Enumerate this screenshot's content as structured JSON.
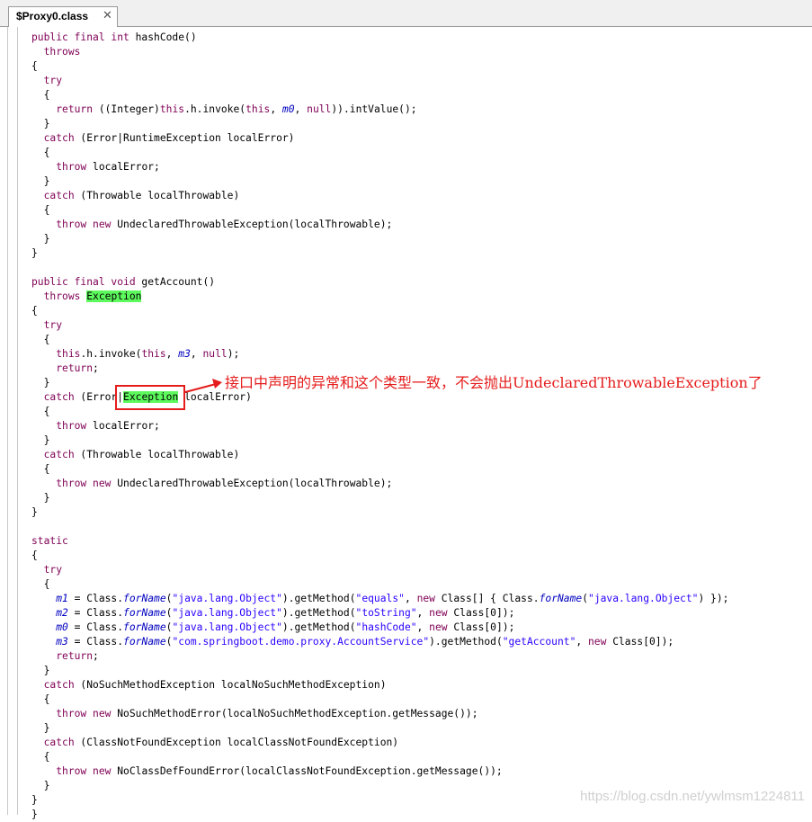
{
  "tab": {
    "title": "$Proxy0.class",
    "close_glyph": "✕"
  },
  "code_lines": [
    [
      {
        "t": "public final int",
        "c": "k"
      },
      {
        "t": " hashCode()",
        "c": "p"
      }
    ],
    [
      {
        "t": "  ",
        "c": "p"
      },
      {
        "t": "throws",
        "c": "k"
      }
    ],
    [
      {
        "t": "{",
        "c": "p"
      }
    ],
    [
      {
        "t": "  ",
        "c": "p"
      },
      {
        "t": "try",
        "c": "k"
      }
    ],
    [
      {
        "t": "  {",
        "c": "p"
      }
    ],
    [
      {
        "t": "    ",
        "c": "p"
      },
      {
        "t": "return",
        "c": "k"
      },
      {
        "t": " ((Integer)",
        "c": "p"
      },
      {
        "t": "this",
        "c": "k"
      },
      {
        "t": ".h.invoke(",
        "c": "p"
      },
      {
        "t": "this",
        "c": "k"
      },
      {
        "t": ", ",
        "c": "p"
      },
      {
        "t": "m0",
        "c": "f"
      },
      {
        "t": ", ",
        "c": "p"
      },
      {
        "t": "null",
        "c": "k"
      },
      {
        "t": ")).intValue();",
        "c": "p"
      }
    ],
    [
      {
        "t": "  }",
        "c": "p"
      }
    ],
    [
      {
        "t": "  ",
        "c": "p"
      },
      {
        "t": "catch",
        "c": "k"
      },
      {
        "t": " (Error|RuntimeException localError)",
        "c": "p"
      }
    ],
    [
      {
        "t": "  {",
        "c": "p"
      }
    ],
    [
      {
        "t": "    ",
        "c": "p"
      },
      {
        "t": "throw",
        "c": "k"
      },
      {
        "t": " localError;",
        "c": "p"
      }
    ],
    [
      {
        "t": "  }",
        "c": "p"
      }
    ],
    [
      {
        "t": "  ",
        "c": "p"
      },
      {
        "t": "catch",
        "c": "k"
      },
      {
        "t": " (Throwable localThrowable)",
        "c": "p"
      }
    ],
    [
      {
        "t": "  {",
        "c": "p"
      }
    ],
    [
      {
        "t": "    ",
        "c": "p"
      },
      {
        "t": "throw new",
        "c": "k"
      },
      {
        "t": " UndeclaredThrowableException(localThrowable);",
        "c": "p"
      }
    ],
    [
      {
        "t": "  }",
        "c": "p"
      }
    ],
    [
      {
        "t": "}",
        "c": "p"
      }
    ],
    [],
    [
      {
        "t": "public final void",
        "c": "k"
      },
      {
        "t": " getAccount()",
        "c": "p"
      }
    ],
    [
      {
        "t": "  ",
        "c": "p"
      },
      {
        "t": "throws",
        "c": "k"
      },
      {
        "t": " ",
        "c": "p"
      },
      {
        "t": "Exception",
        "c": "hl"
      }
    ],
    [
      {
        "t": "{",
        "c": "p"
      }
    ],
    [
      {
        "t": "  ",
        "c": "p"
      },
      {
        "t": "try",
        "c": "k"
      }
    ],
    [
      {
        "t": "  {",
        "c": "p"
      }
    ],
    [
      {
        "t": "    ",
        "c": "p"
      },
      {
        "t": "this",
        "c": "k"
      },
      {
        "t": ".h.invoke(",
        "c": "p"
      },
      {
        "t": "this",
        "c": "k"
      },
      {
        "t": ", ",
        "c": "p"
      },
      {
        "t": "m3",
        "c": "f"
      },
      {
        "t": ", ",
        "c": "p"
      },
      {
        "t": "null",
        "c": "k"
      },
      {
        "t": ");",
        "c": "p"
      }
    ],
    [
      {
        "t": "    ",
        "c": "p"
      },
      {
        "t": "return",
        "c": "k"
      },
      {
        "t": ";",
        "c": "p"
      }
    ],
    [
      {
        "t": "  }",
        "c": "p"
      }
    ],
    [
      {
        "t": "  ",
        "c": "p"
      },
      {
        "t": "catch",
        "c": "k"
      },
      {
        "t": " (Error|",
        "c": "p"
      },
      {
        "t": "Exception",
        "c": "hl"
      },
      {
        "t": " localError)",
        "c": "p"
      }
    ],
    [
      {
        "t": "  {",
        "c": "p"
      }
    ],
    [
      {
        "t": "    ",
        "c": "p"
      },
      {
        "t": "throw",
        "c": "k"
      },
      {
        "t": " localError;",
        "c": "p"
      }
    ],
    [
      {
        "t": "  }",
        "c": "p"
      }
    ],
    [
      {
        "t": "  ",
        "c": "p"
      },
      {
        "t": "catch",
        "c": "k"
      },
      {
        "t": " (Throwable localThrowable)",
        "c": "p"
      }
    ],
    [
      {
        "t": "  {",
        "c": "p"
      }
    ],
    [
      {
        "t": "    ",
        "c": "p"
      },
      {
        "t": "throw new",
        "c": "k"
      },
      {
        "t": " UndeclaredThrowableException(localThrowable);",
        "c": "p"
      }
    ],
    [
      {
        "t": "  }",
        "c": "p"
      }
    ],
    [
      {
        "t": "}",
        "c": "p"
      }
    ],
    [],
    [
      {
        "t": "static",
        "c": "k"
      }
    ],
    [
      {
        "t": "{",
        "c": "p"
      }
    ],
    [
      {
        "t": "  ",
        "c": "p"
      },
      {
        "t": "try",
        "c": "k"
      }
    ],
    [
      {
        "t": "  {",
        "c": "p"
      }
    ],
    [
      {
        "t": "    ",
        "c": "p"
      },
      {
        "t": "m1",
        "c": "f"
      },
      {
        "t": " = Class.",
        "c": "p"
      },
      {
        "t": "forName",
        "c": "f"
      },
      {
        "t": "(",
        "c": "p"
      },
      {
        "t": "\"java.lang.Object\"",
        "c": "s"
      },
      {
        "t": ").getMethod(",
        "c": "p"
      },
      {
        "t": "\"equals\"",
        "c": "s"
      },
      {
        "t": ", ",
        "c": "p"
      },
      {
        "t": "new",
        "c": "k"
      },
      {
        "t": " Class[] { Class.",
        "c": "p"
      },
      {
        "t": "forName",
        "c": "f"
      },
      {
        "t": "(",
        "c": "p"
      },
      {
        "t": "\"java.lang.Object\"",
        "c": "s"
      },
      {
        "t": ") });",
        "c": "p"
      }
    ],
    [
      {
        "t": "    ",
        "c": "p"
      },
      {
        "t": "m2",
        "c": "f"
      },
      {
        "t": " = Class.",
        "c": "p"
      },
      {
        "t": "forName",
        "c": "f"
      },
      {
        "t": "(",
        "c": "p"
      },
      {
        "t": "\"java.lang.Object\"",
        "c": "s"
      },
      {
        "t": ").getMethod(",
        "c": "p"
      },
      {
        "t": "\"toString\"",
        "c": "s"
      },
      {
        "t": ", ",
        "c": "p"
      },
      {
        "t": "new",
        "c": "k"
      },
      {
        "t": " Class[0]);",
        "c": "p"
      }
    ],
    [
      {
        "t": "    ",
        "c": "p"
      },
      {
        "t": "m0",
        "c": "f"
      },
      {
        "t": " = Class.",
        "c": "p"
      },
      {
        "t": "forName",
        "c": "f"
      },
      {
        "t": "(",
        "c": "p"
      },
      {
        "t": "\"java.lang.Object\"",
        "c": "s"
      },
      {
        "t": ").getMethod(",
        "c": "p"
      },
      {
        "t": "\"hashCode\"",
        "c": "s"
      },
      {
        "t": ", ",
        "c": "p"
      },
      {
        "t": "new",
        "c": "k"
      },
      {
        "t": " Class[0]);",
        "c": "p"
      }
    ],
    [
      {
        "t": "    ",
        "c": "p"
      },
      {
        "t": "m3",
        "c": "f"
      },
      {
        "t": " = Class.",
        "c": "p"
      },
      {
        "t": "forName",
        "c": "f"
      },
      {
        "t": "(",
        "c": "p"
      },
      {
        "t": "\"com.springboot.demo.proxy.AccountService\"",
        "c": "s"
      },
      {
        "t": ").getMethod(",
        "c": "p"
      },
      {
        "t": "\"getAccount\"",
        "c": "s"
      },
      {
        "t": ", ",
        "c": "p"
      },
      {
        "t": "new",
        "c": "k"
      },
      {
        "t": " Class[0]);",
        "c": "p"
      }
    ],
    [
      {
        "t": "    ",
        "c": "p"
      },
      {
        "t": "return",
        "c": "k"
      },
      {
        "t": ";",
        "c": "p"
      }
    ],
    [
      {
        "t": "  }",
        "c": "p"
      }
    ],
    [
      {
        "t": "  ",
        "c": "p"
      },
      {
        "t": "catch",
        "c": "k"
      },
      {
        "t": " (NoSuchMethodException localNoSuchMethodException)",
        "c": "p"
      }
    ],
    [
      {
        "t": "  {",
        "c": "p"
      }
    ],
    [
      {
        "t": "    ",
        "c": "p"
      },
      {
        "t": "throw new",
        "c": "k"
      },
      {
        "t": " NoSuchMethodError(localNoSuchMethodException.getMessage());",
        "c": "p"
      }
    ],
    [
      {
        "t": "  }",
        "c": "p"
      }
    ],
    [
      {
        "t": "  ",
        "c": "p"
      },
      {
        "t": "catch",
        "c": "k"
      },
      {
        "t": " (ClassNotFoundException localClassNotFoundException)",
        "c": "p"
      }
    ],
    [
      {
        "t": "  {",
        "c": "p"
      }
    ],
    [
      {
        "t": "    ",
        "c": "p"
      },
      {
        "t": "throw new",
        "c": "k"
      },
      {
        "t": " NoClassDefFoundError(localClassNotFoundException.getMessage());",
        "c": "p"
      }
    ],
    [
      {
        "t": "  }",
        "c": "p"
      }
    ],
    [
      {
        "t": "}",
        "c": "p"
      }
    ],
    [
      {
        "t": "}",
        "c": "p"
      }
    ]
  ],
  "annotation": {
    "text": "接口中声明的异常和这个类型一致，不会抛出UndeclaredThrowableException了",
    "color": "#e51c1c"
  },
  "watermark": "https://blog.csdn.net/ywlmsm1224811",
  "colors": {
    "keyword": "#7f0055",
    "field": "#0000c0",
    "string": "#2a00ff",
    "highlight": "#5dfa5d"
  }
}
